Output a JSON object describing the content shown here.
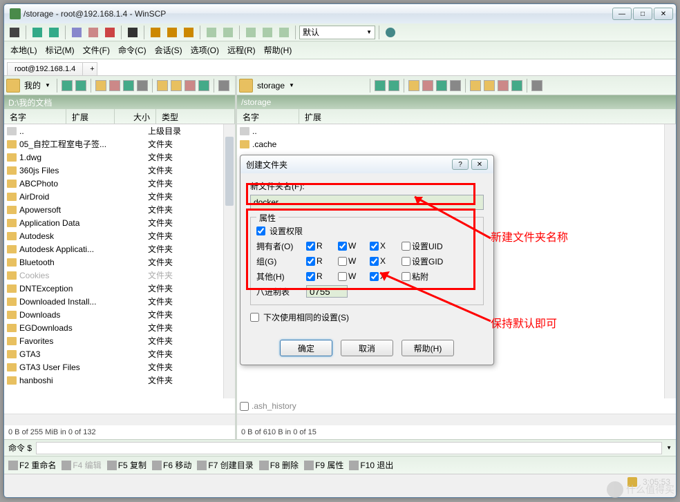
{
  "title": "/storage - root@192.168.1.4 - WinSCP",
  "combo_default": "默认",
  "menu": [
    "本地(L)",
    "标记(M)",
    "文件(F)",
    "命令(C)",
    "会话(S)",
    "选项(O)",
    "远程(R)",
    "帮助(H)"
  ],
  "tab": "root@192.168.1.4",
  "tab_add": "+",
  "left": {
    "nav_label": "我的",
    "path": "D:\\我的文档",
    "columns": [
      "名字",
      "扩展",
      "大小",
      "类型"
    ],
    "rows": [
      {
        "name": "..",
        "type": "上级目录",
        "up": true
      },
      {
        "name": "05_自控工程室电子签...",
        "type": "文件夹"
      },
      {
        "name": "1.dwg",
        "type": "文件夹"
      },
      {
        "name": "360js Files",
        "type": "文件夹"
      },
      {
        "name": "ABCPhoto",
        "type": "文件夹"
      },
      {
        "name": "AirDroid",
        "type": "文件夹"
      },
      {
        "name": "Apowersoft",
        "type": "文件夹"
      },
      {
        "name": "Application Data",
        "type": "文件夹"
      },
      {
        "name": "Autodesk",
        "type": "文件夹"
      },
      {
        "name": "Autodesk Applicati...",
        "type": "文件夹"
      },
      {
        "name": "Bluetooth",
        "type": "文件夹"
      },
      {
        "name": "Cookies",
        "type": "文件夹",
        "grey": true
      },
      {
        "name": "DNTException",
        "type": "文件夹"
      },
      {
        "name": "Downloaded Install...",
        "type": "文件夹"
      },
      {
        "name": "Downloads",
        "type": "文件夹"
      },
      {
        "name": "EGDownloads",
        "type": "文件夹"
      },
      {
        "name": "Favorites",
        "type": "文件夹"
      },
      {
        "name": "GTA3",
        "type": "文件夹"
      },
      {
        "name": "GTA3 User Files",
        "type": "文件夹"
      },
      {
        "name": "hanboshi",
        "type": "文件夹"
      }
    ],
    "status": "0 B of 255 MiB in 0 of 132"
  },
  "right": {
    "nav_label": "storage",
    "path": "/storage",
    "columns": [
      "名字",
      "扩展"
    ],
    "rows": [
      {
        "name": "..",
        "up": true
      },
      {
        "name": ".cache"
      }
    ],
    "bottom_row": ".ash_history",
    "status": "0 B of 610 B in 0 of 15"
  },
  "cmd_label": "命令 $",
  "fkeys": [
    {
      "label": "F2 重命名"
    },
    {
      "label": "F4 编辑",
      "grey": true
    },
    {
      "label": "F5 复制"
    },
    {
      "label": "F6 移动"
    },
    {
      "label": "F7 创建目录"
    },
    {
      "label": "F8 删除"
    },
    {
      "label": "F9 属性"
    },
    {
      "label": "F10 退出"
    }
  ],
  "time": "3:05:53",
  "dialog": {
    "title": "创建文件夹",
    "name_label": "新文件夹名(F):",
    "name_value": "docker",
    "group_title": "属性",
    "set_perm": "设置权限",
    "owner": "拥有者(O)",
    "group": "组(G)",
    "other": "其他(H)",
    "R": "R",
    "W": "W",
    "X": "X",
    "suid": "设置UID",
    "sgid": "设置GID",
    "sticky": "粘附",
    "octal_label": "八进制表",
    "octal_value": "0755",
    "remember": "下次使用相同的设置(S)",
    "ok": "确定",
    "cancel": "取消",
    "help": "帮助(H)"
  },
  "anno1": "新建文件夹名称",
  "anno2": "保持默认即可",
  "watermark": "什么值得买"
}
